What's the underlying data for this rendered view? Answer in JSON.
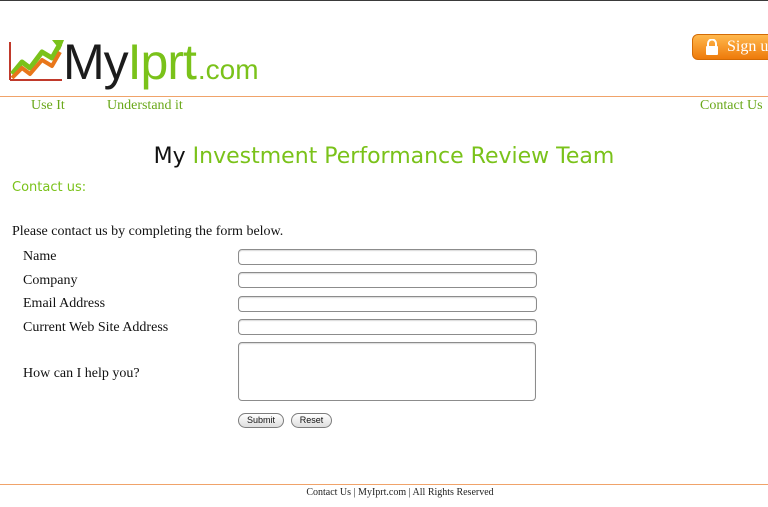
{
  "header": {
    "logo_my": "My",
    "logo_iprt": "Iprt",
    "logo_com": ".com",
    "signup_label": "Sign up"
  },
  "nav": {
    "use_it": "Use It",
    "understand_it": "Understand it",
    "contact_us": "Contact Us"
  },
  "main": {
    "title_my": "My",
    "title_rest": "Investment Performance Review Team",
    "contact_heading": "Contact us:",
    "intro": "Please contact us by completing the form below."
  },
  "form": {
    "name_label": "Name",
    "company_label": "Company",
    "email_label": "Email Address",
    "website_label": "Current Web Site Address",
    "help_label": "How can I help you?",
    "name_value": "",
    "company_value": "",
    "email_value": "",
    "website_value": "",
    "help_value": "",
    "submit_label": "Submit",
    "reset_label": "Reset"
  },
  "footer": {
    "text": "Contact Us | MyIprt.com | All Rights Reserved"
  },
  "colors": {
    "brand_green": "#7ac21a",
    "accent_orange": "#ee7a0a",
    "divider_orange": "#f0a36a"
  }
}
